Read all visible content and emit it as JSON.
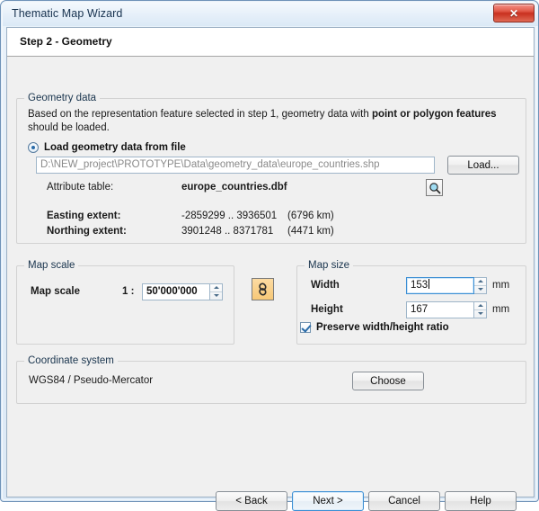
{
  "window": {
    "title": "Thematic Map Wizard",
    "close_label": "✕"
  },
  "step": {
    "title": "Step 2 - Geometry"
  },
  "geometry_group": {
    "title": "Geometry data",
    "description_part1": "Based on the representation feature selected in step 1, geometry data with ",
    "description_bold": "point or polygon features",
    "description_part2": " should be loaded.",
    "radio_label": "Load geometry data from file",
    "path_value": "D:\\NEW_project\\PROTOTYPE\\Data\\geometry_data\\europe_countries.shp",
    "load_button": "Load...",
    "attribute_table_label": "Attribute table:",
    "attribute_table_value": "europe_countries.dbf",
    "magnifier_icon": "search-icon",
    "easting_label": "Easting extent:",
    "easting_value": "-2859299 .. 3936501",
    "easting_span": "(6796 km)",
    "northing_label": "Northing extent:",
    "northing_value": "3901248 .. 8371781",
    "northing_span": "(4471 km)"
  },
  "map_scale_group": {
    "title": "Map scale",
    "label": "Map scale",
    "ratio_prefix": "1 :",
    "value": "50'000'000"
  },
  "link_button": {
    "icon": "chain-link-icon"
  },
  "map_size_group": {
    "title": "Map size",
    "width_label": "Width",
    "width_value": "153",
    "width_unit": "mm",
    "height_label": "Height",
    "height_value": "167",
    "height_unit": "mm",
    "preserve_ratio_label": "Preserve width/height ratio"
  },
  "coordinate_group": {
    "title": "Coordinate system",
    "value": "WGS84 / Pseudo-Mercator",
    "choose_button": "Choose"
  },
  "footer": {
    "back": "< Back",
    "next": "Next >",
    "cancel": "Cancel",
    "help": "Help"
  },
  "colors": {
    "accent": "#3c8fd4",
    "close_red": "#c9301f",
    "link_orange": "#f7c877",
    "client_bg": "#f0f0f0"
  }
}
